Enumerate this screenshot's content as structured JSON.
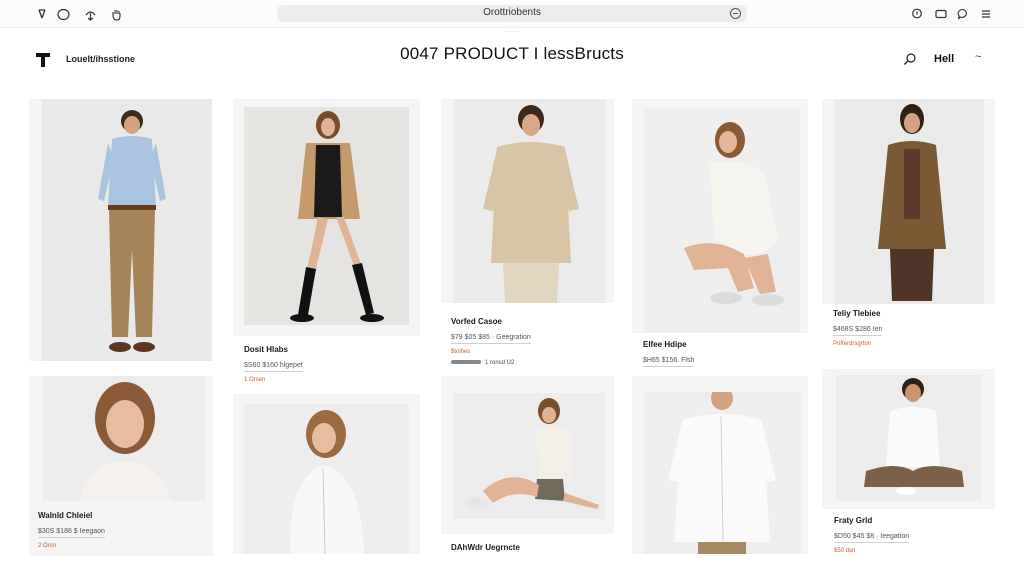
{
  "browser": {
    "url": "Orottriobents",
    "url_sub": "· · · · ·"
  },
  "header": {
    "brand": "Louelt/ihsstione",
    "title": "0047 PRODUCT I lessBructs",
    "user": "Hell"
  },
  "icons": {
    "back": "back-icon",
    "circle": "circle-icon",
    "share": "share-icon",
    "hand": "hand-icon",
    "location": "location-pin-icon",
    "window": "window-icon",
    "chat": "chat-bubble-icon",
    "menu": "menu-icon",
    "search": "search-icon",
    "chevron": "chevron-down-icon"
  },
  "colors": {
    "accent": "#c2622c",
    "card_bg": "#f4f4f4"
  },
  "products": [
    {
      "name": "",
      "price": "",
      "extra": ""
    },
    {
      "name": "Dosit Hlabs",
      "price": "$S60 $160 hlgepet",
      "extra": "1 Orsen"
    },
    {
      "name": "Vorfed Casoe",
      "price": "$79 $05 $85 · Geegration",
      "extra": "$tolhes",
      "extra2": "1 ronsd U2"
    },
    {
      "name": "Elfee Hdipe",
      "price": "$H65 $156. Flsh",
      "extra": ""
    },
    {
      "name": "Teliy Tlebiee",
      "price": "$468S $286 Ien",
      "extra": "Prifterdrsgrton"
    },
    {
      "name": "Walnld Chleiel",
      "price": "$30S $186 $ Ieegaon",
      "extra": "2 Orsn"
    },
    {
      "name": "",
      "price": "",
      "extra": ""
    },
    {
      "name": "DAhWdr Uegrncte",
      "price": "",
      "extra": ""
    },
    {
      "name": "",
      "price": "",
      "extra": ""
    },
    {
      "name": "Fraty Grld",
      "price": "$D50 $45 $8 · Ieegation",
      "extra": "$50 dsn"
    }
  ]
}
